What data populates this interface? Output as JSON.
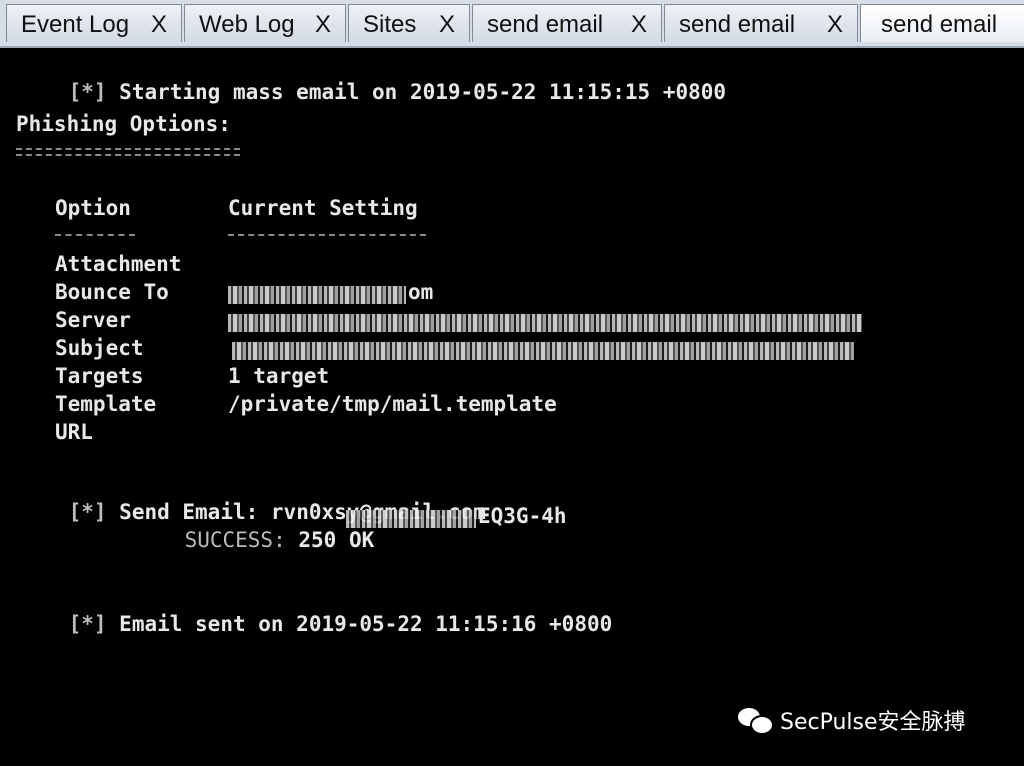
{
  "tabs": [
    {
      "label": "Event Log",
      "close": "X"
    },
    {
      "label": "Web Log",
      "close": "X"
    },
    {
      "label": "Sites",
      "close": "X"
    },
    {
      "label": "send email",
      "close": "X"
    },
    {
      "label": "send email",
      "close": "X"
    },
    {
      "label": "send email",
      "close": ""
    }
  ],
  "console": {
    "start": {
      "prefix": "[*]",
      "text": "Starting mass email on 2019-05-22 11:15:15 +0800"
    },
    "options_title": "Phishing Options:",
    "col_option": "Option",
    "col_setting": "Current Setting",
    "options": [
      {
        "name": "Attachment",
        "value": ""
      },
      {
        "name": "Bounce To",
        "value": "om"
      },
      {
        "name": "Server",
        "value": ""
      },
      {
        "name": "Subject",
        "value": ""
      },
      {
        "name": "Targets",
        "value": "1 target"
      },
      {
        "name": "Template",
        "value": "/private/tmp/mail.template"
      },
      {
        "name": "URL",
        "value": ""
      }
    ],
    "send": {
      "prefix": "[*]",
      "label": "Send Email:",
      "address": "rvn0xsy@gmail.com"
    },
    "success": {
      "label": "SUCCESS:",
      "text": "250 OK",
      "suffix": "EQ3G-4h"
    },
    "sent": {
      "prefix": "[*]",
      "text": "Email sent on 2019-05-22 11:15:16 +0800"
    }
  },
  "watermark": {
    "text": "SecPulse安全脉搏",
    "icon": "wechat-icon"
  }
}
